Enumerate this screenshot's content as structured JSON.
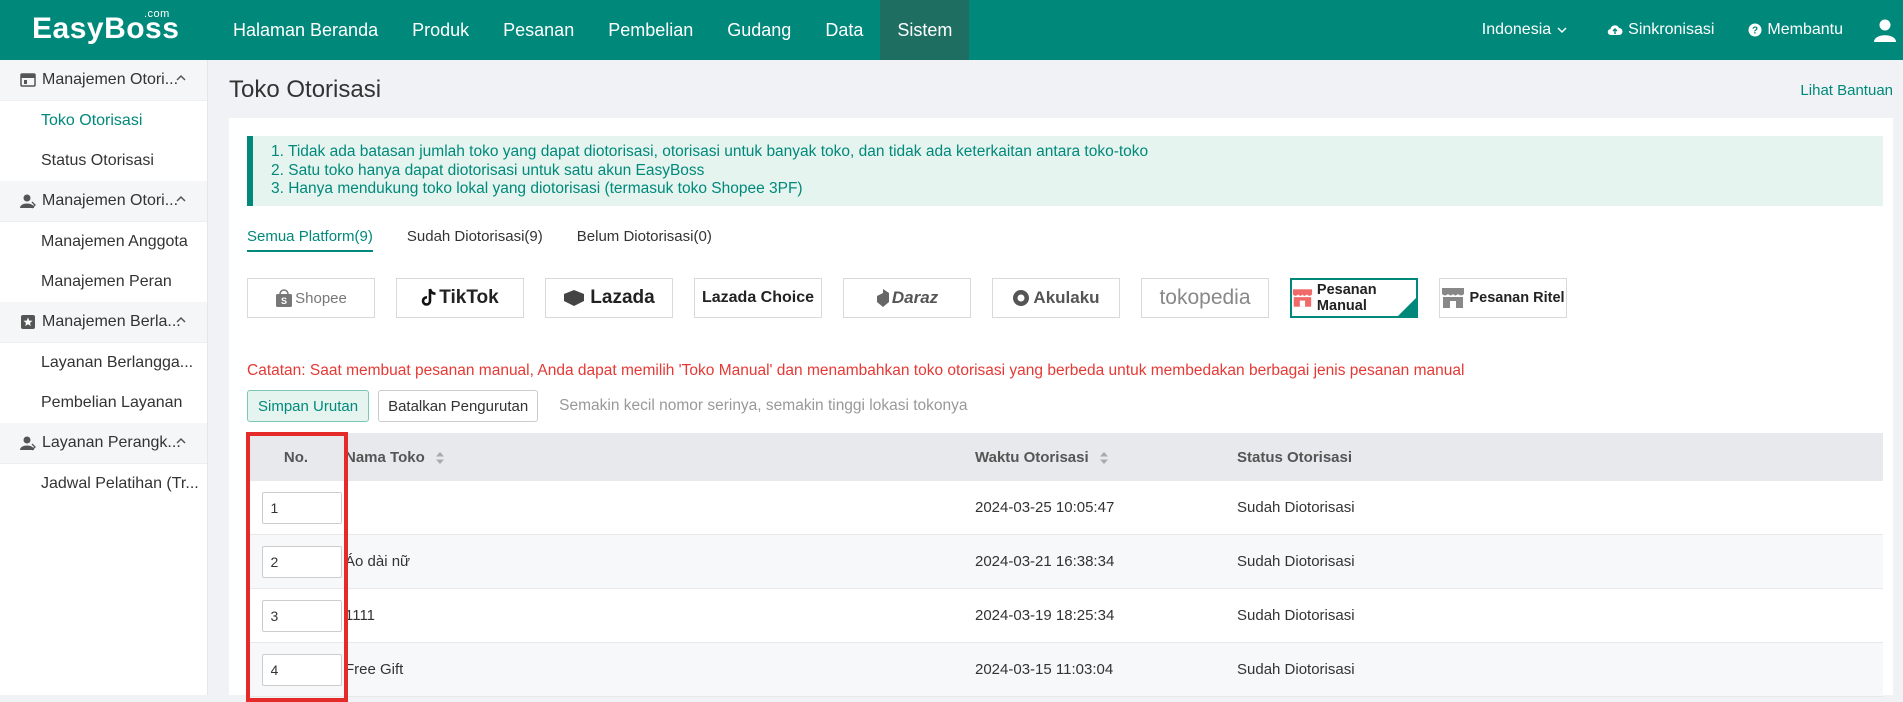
{
  "app": {
    "logo": "EasyBoss",
    "logo_suffix": ".com",
    "nav": [
      "Halaman Beranda",
      "Produk",
      "Pesanan",
      "Pembelian",
      "Gudang",
      "Data",
      "Sistem"
    ],
    "active_nav": "Sistem",
    "language": "Indonesia",
    "sync_label": "Sinkronisasi",
    "help_label": "Membantu"
  },
  "sidebar": {
    "groups": [
      {
        "title": "Manajemen Otori...",
        "items": [
          "Toko Otorisasi",
          "Status Otorisasi"
        ]
      },
      {
        "title": "Manajemen Otori...",
        "items": [
          "Manajemen Anggota",
          "Manajemen Peran"
        ]
      },
      {
        "title": "Manajemen Berla...",
        "items": [
          "Layanan Berlangga...",
          "Pembelian Layanan"
        ]
      },
      {
        "title": "Layanan Perangk...",
        "items": [
          "Jadwal Pelatihan (Tr..."
        ]
      }
    ],
    "active_item": "Toko Otorisasi"
  },
  "page": {
    "title": "Toko Otorisasi",
    "help_link": "Lihat Bantuan",
    "notice": [
      "1. Tidak ada batasan jumlah toko yang dapat diotorisasi, otorisasi untuk banyak toko, dan tidak ada keterkaitan antara toko-toko",
      "2. Satu toko hanya dapat diotorisasi untuk satu akun EasyBoss",
      "3. Hanya mendukung toko lokal yang diotorisasi (termasuk toko Shopee 3PF)"
    ],
    "tabs": [
      "Semua Platform(9)",
      "Sudah Diotorisasi(9)",
      "Belum Diotorisasi(0)"
    ],
    "platforms": [
      "Shopee",
      "TikTok",
      "Lazada",
      "Lazada Choice",
      "Daraz",
      "Akulaku",
      "tokopedia",
      "Pesanan Manual",
      "Pesanan Ritel"
    ],
    "selected_platform": "Pesanan Manual",
    "warning": "Catatan: Saat membuat pesanan manual, Anda dapat memilih 'Toko Manual' dan menambahkan toko otorisasi yang berbeda untuk membedakan berbagai jenis pesanan manual",
    "save_order": "Simpan Urutan",
    "cancel_order": "Batalkan Pengurutan",
    "sort_hint": "Semakin kecil nomor serinya, semakin tinggi lokasi tokonya",
    "table": {
      "headers": [
        "No.",
        "Nama Toko",
        "Waktu Otorisasi",
        "Status Otorisasi"
      ],
      "rows": [
        {
          "no": "1",
          "name": "",
          "time": "2024-03-25 10:05:47",
          "status": "Sudah Diotorisasi"
        },
        {
          "no": "2",
          "name": "Áo dài nữ",
          "time": "2024-03-21 16:38:34",
          "status": "Sudah Diotorisasi"
        },
        {
          "no": "3",
          "name": "1111",
          "time": "2024-03-19 18:25:34",
          "status": "Sudah Diotorisasi"
        },
        {
          "no": "4",
          "name": "Free Gift",
          "time": "2024-03-15 11:03:04",
          "status": "Sudah Diotorisasi"
        }
      ]
    }
  },
  "colors": {
    "brand": "#00897b",
    "warning": "#e53935",
    "highlight": "#e52a2a"
  }
}
